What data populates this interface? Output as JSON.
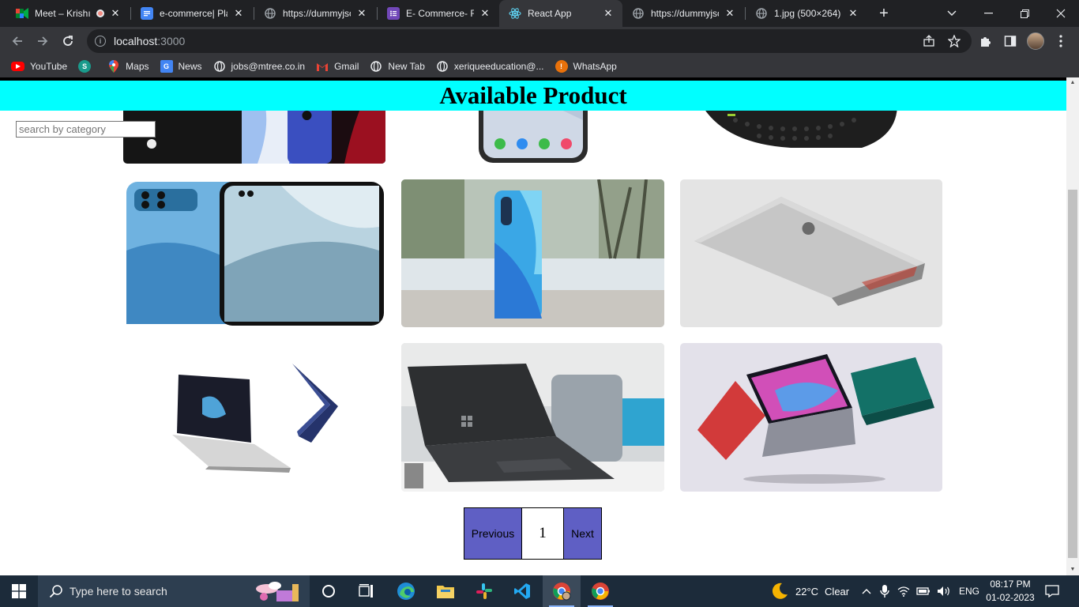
{
  "browser": {
    "tabs": [
      {
        "title": "Meet – Krishı",
        "icon": "google-meet-icon",
        "recording": true
      },
      {
        "title": "e-commerce| Plar",
        "icon": "google-docs-icon"
      },
      {
        "title": "https://dummyjsc",
        "icon": "globe-icon"
      },
      {
        "title": "E- Commerce- Fr",
        "icon": "google-forms-icon"
      },
      {
        "title": "React App",
        "icon": "react-icon",
        "active": true
      },
      {
        "title": "https://dummyjsc",
        "icon": "globe-icon"
      },
      {
        "title": "1.jpg (500×264)",
        "icon": "globe-icon"
      }
    ],
    "close_glyph": "✕",
    "new_tab_glyph": "+",
    "url_host": "localhost",
    "url_port": ":3000",
    "bookmarks": [
      {
        "label": "YouTube",
        "icon": "youtube-icon",
        "color": "#ff0000"
      },
      {
        "label": "",
        "icon": "extension-globe-icon",
        "color": "#1a9b8c"
      },
      {
        "label": "Maps",
        "icon": "maps-icon",
        "color": "#34a853"
      },
      {
        "label": "News",
        "icon": "news-icon",
        "color": "#4285f4"
      },
      {
        "label": "jobs@mtree.co.in",
        "icon": "globe-icon",
        "color": "#9aa0a6"
      },
      {
        "label": "Gmail",
        "icon": "gmail-icon",
        "color": "#ea4335"
      },
      {
        "label": "New Tab",
        "icon": "globe-icon",
        "color": "#9aa0a6"
      },
      {
        "label": "xeriqueeducation@...",
        "icon": "globe-icon",
        "color": "#9aa0a6"
      },
      {
        "label": "WhatsApp",
        "icon": "warning-icon",
        "color": "#e8710a"
      }
    ]
  },
  "page": {
    "heading": "Available Product",
    "search_placeholder": "search by category",
    "banner_color": "#00ffff",
    "products": [
      {
        "name": "iphone-blue-image"
      },
      {
        "name": "iphone-x-image"
      },
      {
        "name": "keyboard-phone-image"
      },
      {
        "name": "oppo-f19-image"
      },
      {
        "name": "huawei-p30-image"
      },
      {
        "name": "macbook-pro-image"
      },
      {
        "name": "samsung-galaxy-book-image"
      },
      {
        "name": "microsoft-surface-laptop-image"
      },
      {
        "name": "infinix-inbook-image"
      }
    ],
    "pagination": {
      "previous": "Previous",
      "current": "1",
      "next": "Next",
      "button_color": "#5f5fc4"
    }
  },
  "taskbar": {
    "search_placeholder": "Type here to search",
    "apps": [
      "task-view",
      "edge",
      "file-explorer",
      "slack",
      "vscode",
      "chrome-profile",
      "chrome"
    ],
    "weather_temp": "22°C",
    "weather_desc": "Clear",
    "language": "ENG",
    "time": "08:17 PM",
    "date": "01-02-2023"
  }
}
